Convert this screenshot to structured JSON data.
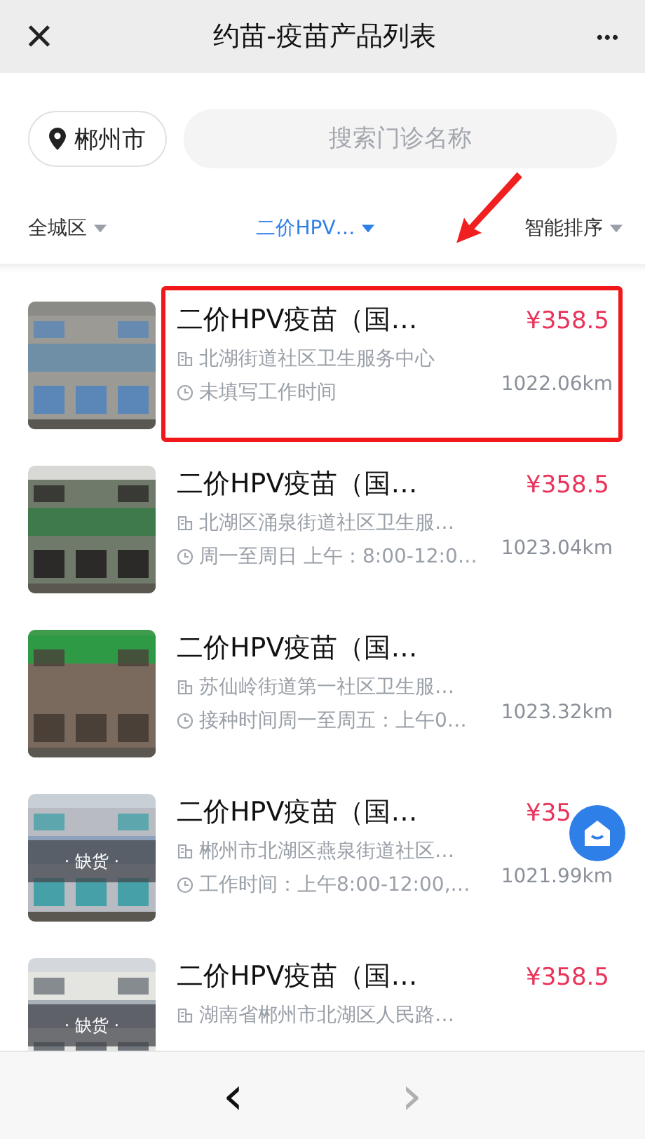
{
  "header": {
    "close": "×",
    "title": "约苗-疫苗产品列表",
    "more": "•••"
  },
  "location": {
    "city": "郴州市"
  },
  "search": {
    "placeholder": "搜索门诊名称"
  },
  "filters": [
    {
      "label": "全城区",
      "selected": false
    },
    {
      "label": "二价HPV…",
      "selected": true
    },
    {
      "label": "智能排序",
      "selected": false
    }
  ],
  "items": [
    {
      "title": "二价HPV疫苗（国…",
      "price": "¥358.5",
      "address": "北湖街道社区卫生服务中心",
      "hours": "未填写工作时间",
      "distance": "1022.06km",
      "highlighted": true
    },
    {
      "title": "二价HPV疫苗（国…",
      "price": "¥358.5",
      "address": "北湖区涌泉街道社区卫生服…",
      "hours": "周一至周日 上午：8:00-12:0…",
      "distance": "1023.04km",
      "highlighted": false
    },
    {
      "title": "二价HPV疫苗（国…",
      "address": "苏仙岭街道第一社区卫生服…",
      "hours": "接种时间周一至周五：上午0…",
      "distance": "1023.32km",
      "highlighted": false
    },
    {
      "title": "二价HPV疫苗（国…",
      "price": "¥35",
      "address": "郴州市北湖区燕泉街道社区…",
      "hours": "工作时间：上午8:00-12:00,…",
      "distance": "1021.99km",
      "badge": "· 缺货 ·",
      "highlighted": false
    },
    {
      "title": "二价HPV疫苗（国…",
      "price": "¥358.5",
      "address": "湖南省郴州市北湖区人民路…",
      "badge": "· 缺货 ·",
      "highlighted": false
    }
  ],
  "annotation": {
    "arrow": true
  },
  "bottom_bar": {
    "back": "‹",
    "forward": "›",
    "forward_disabled": true
  }
}
